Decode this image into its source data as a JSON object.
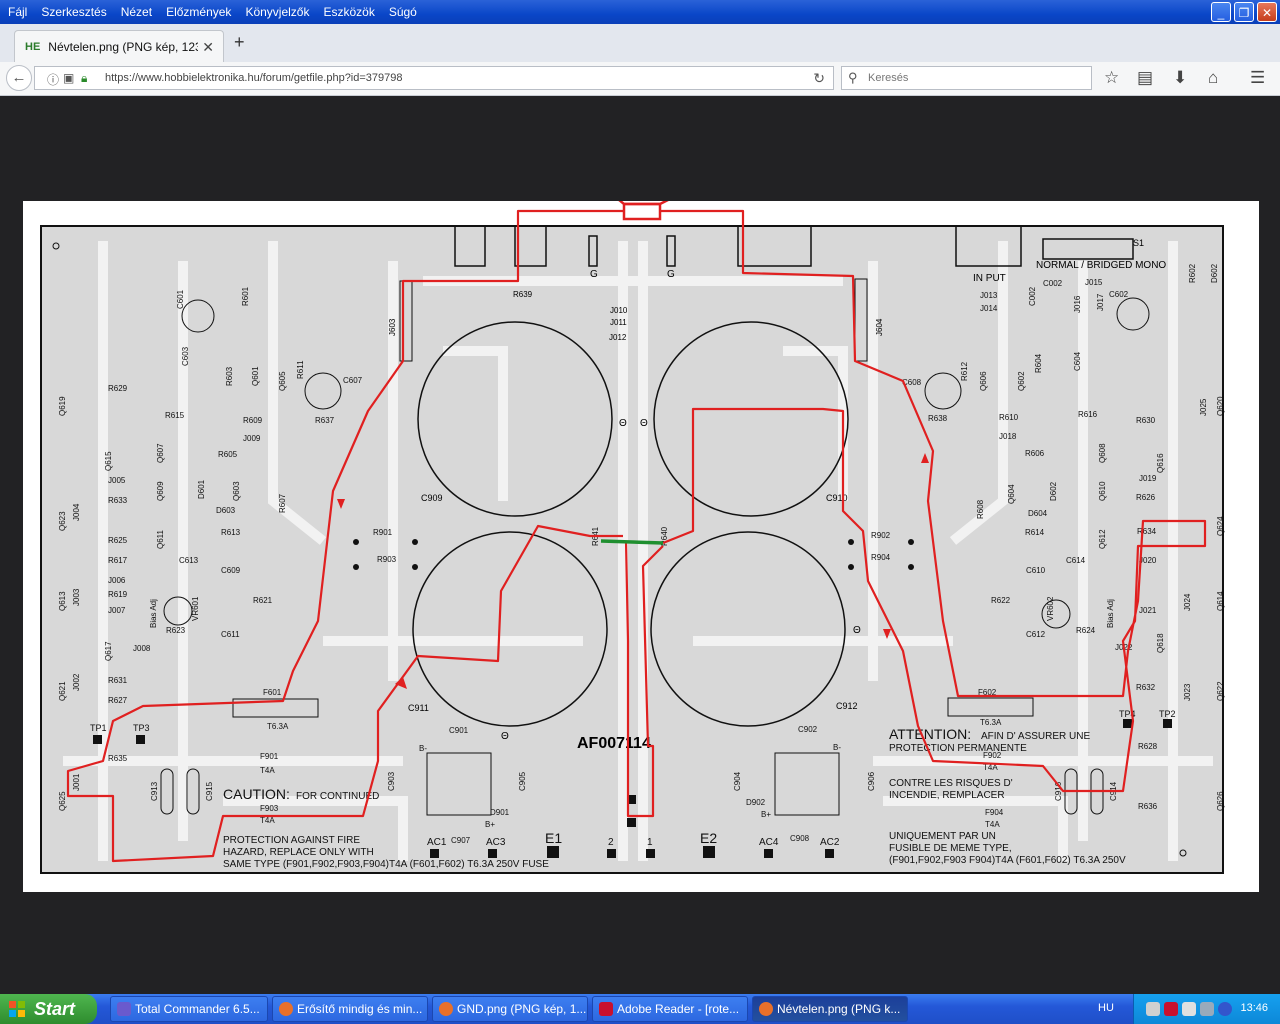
{
  "menu": [
    "Fájl",
    "Szerkesztés",
    "Nézet",
    "Előzmények",
    "Könyvjelzők",
    "Eszközök",
    "Súgó"
  ],
  "window_controls": {
    "minimize": "_",
    "maximize": "❐",
    "close": "✕"
  },
  "tab": {
    "favicon": "HE",
    "title": "Névtelen.png (PNG kép, 1237...",
    "close": "✕",
    "new_tab": "+"
  },
  "nav": {
    "url": "https://www.hobbielektronika.hu/forum/getfile.php?id=379798",
    "search_placeholder": "Keresés",
    "icons": [
      "back-icon",
      "info-icon",
      "lock-icon",
      "reload-icon",
      "bookmark-star-icon",
      "reading-list-icon",
      "download-icon",
      "home-icon",
      "menu-icon"
    ]
  },
  "schematic": {
    "labels": {
      "s1": "S1",
      "normal_bridged": "NORMAL / BRIDGED MONO",
      "input": "IN PUT",
      "j603": "J603",
      "j604": "J604",
      "j010": "J010",
      "j011": "J011",
      "j012": "J012",
      "j013": "J013",
      "j014": "J014",
      "j015": "J015",
      "j016": "J016",
      "j017": "J017",
      "c601": "C601",
      "c602": "C602",
      "c603": "C603",
      "c604": "C604",
      "c607": "C607",
      "c608": "C608",
      "c002": "C002",
      "r601": "R601",
      "r602": "R602",
      "r603": "R603",
      "r604": "R604",
      "r611": "R611",
      "r612": "R612",
      "r629": "R629",
      "r615": "R615",
      "r609": "R609",
      "r637": "R637",
      "r605": "R605",
      "r633": "R633",
      "r625": "R625",
      "r617": "R617",
      "r619": "R619",
      "r623": "R623",
      "r621": "R621",
      "r627": "R627",
      "r631": "R631",
      "r635": "R635",
      "r613": "R613",
      "r639": "R639",
      "r630": "R630",
      "r616": "R616",
      "r610": "R610",
      "r638": "R638",
      "r606": "R606",
      "r626": "R626",
      "r634": "R634",
      "r614": "R614",
      "r622": "R622",
      "r624": "R624",
      "r632": "R632",
      "r628": "R628",
      "r636": "R636",
      "r608": "R608",
      "r607": "R607",
      "r901": "R901",
      "r902": "R902",
      "r903": "R903",
      "r904": "R904",
      "r641": "R641",
      "r640": "R640",
      "q619": "Q619",
      "q623": "Q623",
      "q613": "Q613",
      "q621": "Q621",
      "q625": "Q625",
      "q615": "Q615",
      "q607": "Q607",
      "q609": "Q609",
      "q611": "Q611",
      "q617": "Q617",
      "q601": "Q601",
      "q603": "Q603",
      "q605": "Q605",
      "q620": "Q620",
      "q624": "Q624",
      "q614": "Q614",
      "q622": "Q622",
      "q626": "Q626",
      "q616": "Q616",
      "q608": "Q608",
      "q610": "Q610",
      "q612": "Q612",
      "q618": "Q618",
      "q602": "Q602",
      "q604": "Q604",
      "q606": "Q606",
      "j005": "J005",
      "j004": "J004",
      "j006": "J006",
      "j003": "J003",
      "j007": "J007",
      "j008": "J008",
      "j002": "J002",
      "j001": "J001",
      "j009": "J009",
      "j018": "J018",
      "j019": "J019",
      "j020": "J020",
      "j021": "J021",
      "j022": "J022",
      "j023": "J023",
      "j024": "J024",
      "j025": "J025",
      "d601": "D601",
      "d603": "D603",
      "d602": "D602",
      "d604": "D604",
      "d901": "D901",
      "d902": "D902",
      "c609": "C609",
      "c611": "C611",
      "c613": "C613",
      "c610": "C610",
      "c612": "C612",
      "c614": "C614",
      "vr601": "VR601",
      "vr602": "VR602",
      "bias_adj": "Bias Adj",
      "c909": "C909",
      "c910": "C910",
      "c911": "C911",
      "c912": "C912",
      "c913": "C913",
      "c915": "C915",
      "c914": "C914",
      "c916": "C916",
      "c901": "C901",
      "c902": "C902",
      "c903": "C903",
      "c904": "C904",
      "c905": "C905",
      "c906": "C906",
      "c907": "C907",
      "c908": "C908",
      "f601": "F601",
      "f602": "F602",
      "t63a": "T6.3A",
      "f901": "F901",
      "f902": "F902",
      "f903": "F903",
      "f904": "F904",
      "t4a": "T4A",
      "tp1": "TP1",
      "tp3": "TP3",
      "tp2": "TP2",
      "tp4": "TP4",
      "g": "G",
      "plus": "B+",
      "minus": "B-",
      "e": "E",
      "b": "B",
      "model": "AF007114",
      "caution": "CAUTION:",
      "caution_rest": "FOR CONTINUED",
      "protection1": "PROTECTION AGAINST FIRE",
      "protection2": "HAZARD, REPLACE ONLY WITH",
      "protection3": "SAME TYPE (F901,F902,F903,F904)T4A (F601,F602) T6.3A 250V FUSE",
      "attention": "ATTENTION:",
      "attention_rest": "AFIN D' ASSURER UNE",
      "attention2": "PROTECTION PERMANENTE",
      "contre1": "CONTRE LES RISQUES D'",
      "contre2": "INCENDIE, REMPLACER",
      "uniq1": "UNIQUEMENT PAR UN",
      "uniq2": "FUSIBLE DE MEME TYPE,",
      "uniq3": "(F901,F902,F903 F904)T4A (F601,F602) T6.3A 250V",
      "ac1": "AC1",
      "ac3": "AC3",
      "ac4": "AC4",
      "ac2": "AC2",
      "e1": "E1",
      "e2": "E2",
      "n1": "1",
      "n2": "2",
      "theta": "Θ"
    }
  },
  "taskbar": {
    "start": "Start",
    "tasks": [
      {
        "label": "Total Commander 6.5...",
        "color": "#6a5acd"
      },
      {
        "label": "Erősítő mindig és min...",
        "color": "#e8702a"
      },
      {
        "label": "GND.png (PNG kép, 1...",
        "color": "#e8702a"
      },
      {
        "label": "Adobe Reader - [rote...",
        "color": "#c8102e"
      },
      {
        "label": "Névtelen.png (PNG k...",
        "color": "#e8702a"
      }
    ],
    "language": "HU",
    "clock": "13:46"
  },
  "colors": {
    "trace": "#e02020",
    "green_link": "#1f8f2f",
    "pcb_bg": "#d8d8d8",
    "outline": "#111111"
  }
}
